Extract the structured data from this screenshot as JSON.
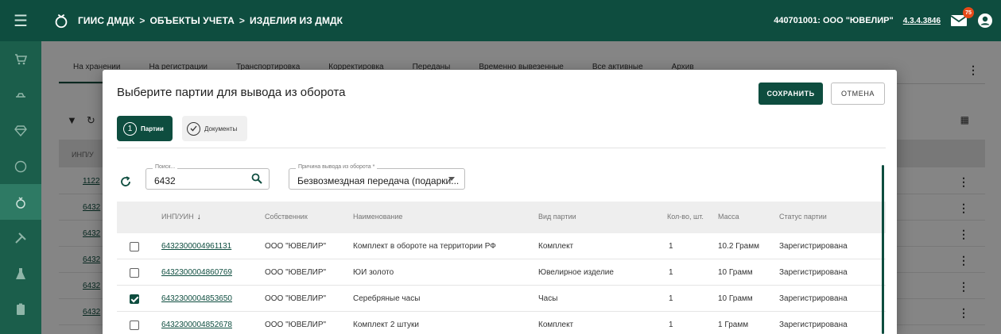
{
  "header": {
    "breadcrumb": [
      "ГИИС ДМДК",
      "ОБЪЕКТЫ УЧЕТА",
      "ИЗДЕЛИЯ ИЗ ДМДК"
    ],
    "separator": ">",
    "org": "440701001: ООО \"ЮВЕЛИР\"",
    "version": "4.3.4.3846",
    "notifications_count": "75"
  },
  "sidebar": {
    "items": [
      "cart-icon",
      "scales-icon",
      "diamond-icon",
      "circle-icon",
      "ring-icon",
      "tools-icon",
      "flask-icon",
      "document-icon"
    ],
    "active_index": 4
  },
  "background": {
    "tabs": [
      "На хранении",
      "На регистрации",
      "Транспортировка",
      "Корректировка",
      "Переданы",
      "Временно вывезенные",
      "Все активные",
      "Архив"
    ],
    "active_tab": 0,
    "header_col": "ИНП/У",
    "row_ids": [
      "1122",
      "6432",
      "6432",
      "6432",
      "6432",
      "6432"
    ]
  },
  "dialog": {
    "title": "Выберите партии для вывода из оборота",
    "save_label": "СОХРАНИТЬ",
    "cancel_label": "ОТМЕНА",
    "steps": [
      {
        "number": "1",
        "label": "Партии",
        "active": true
      },
      {
        "label": "Документы",
        "active": false
      }
    ],
    "search": {
      "label": "Поиск...",
      "value": "6432"
    },
    "reason": {
      "label": "Причина вывода из оборота *",
      "value": "Безвозмездная передача (подарки..."
    },
    "columns": [
      "ИНП/УИН",
      "Собственник",
      "Наименование",
      "Вид партии",
      "Кол-во, шт.",
      "Масса",
      "Статус партии"
    ],
    "rows": [
      {
        "checked": false,
        "id": "6432300004961131",
        "owner": "ООО \"ЮВЕЛИР\"",
        "name": "Комплект в обороте на территории РФ",
        "kind": "Комплект",
        "qty": "1",
        "mass": "10.2 Грамм",
        "status": "Зарегистрирована"
      },
      {
        "checked": false,
        "id": "6432300004860769",
        "owner": "ООО \"ЮВЕЛИР\"",
        "name": "ЮИ золото",
        "kind": "Ювелирное изделие",
        "qty": "1",
        "mass": "10 Грамм",
        "status": "Зарегистрирована"
      },
      {
        "checked": true,
        "id": "6432300004853650",
        "owner": "ООО \"ЮВЕЛИР\"",
        "name": "Серебряные часы",
        "kind": "Часы",
        "qty": "1",
        "mass": "10 Грамм",
        "status": "Зарегистрирована"
      },
      {
        "checked": false,
        "id": "6432300004852678",
        "owner": "ООО \"ЮВЕЛИР\"",
        "name": "Комплект 2 штуки",
        "kind": "Комплект",
        "qty": "1",
        "mass": "1 Грамм",
        "status": "Зарегистрирована"
      }
    ]
  },
  "colors": {
    "primary": "#0e4d3f",
    "sidebar": "#1b5e4b",
    "accent_badge": "#e64a19"
  }
}
